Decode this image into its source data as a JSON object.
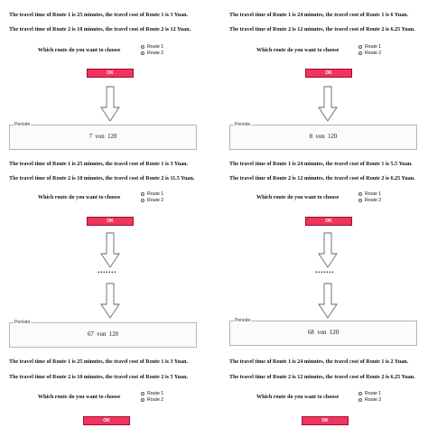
{
  "question": "Which route do you want to choose",
  "route_options": [
    "Route 1",
    "Route 2"
  ],
  "ok_label": "OK",
  "periode_label": "Periode",
  "ellipsis": ".......",
  "left": {
    "screen1": {
      "line1": "The travel time of Route 1 is 25 minutes, the travel cost of Route 1 is 3 Yuan.",
      "line2": "The travel time of Route 2 is 10 minutes, the travel cost of Route 2 is 12 Yuan."
    },
    "screen2": {
      "periode": "7  von  120",
      "line1": "The travel time of Route 1 is 25 minutes, the travel cost of Route 1 is 3 Yuan.",
      "line2": "The travel time of Route 2 is 10 minutes, the travel cost of Route 2 is 11.5 Yuan."
    },
    "screen3": {
      "periode": "67  von  120",
      "line1": "The travel time of Route 1 is 25 minutes, the travel cost of Route 1 is 3 Yuan.",
      "line2": "The travel time of Route 2 is 10 minutes, the travel cost of Route 2 is 5 Yuan."
    }
  },
  "right": {
    "screen1": {
      "line1": "The travel time of Route 1 is 24 minutes, the travel cost of Route 1 is 6 Yuan.",
      "line2": "The travel time of Route 2 is 12 minutes, the travel cost of Route 2 is 6.25 Yuan."
    },
    "screen2": {
      "periode": "8  von  120",
      "line1": "The travel time of Route 1 is 24 minutes, the travel cost of Route 1 is 5.5 Yuan.",
      "line2": "The travel time of Route 2 is 12 minutes, the travel cost of Route 2 is 6.25 Yuan."
    },
    "screen3": {
      "periode": "68  von  120",
      "line1": "The travel time of Route 1 is 24 minutes, the travel cost of Route 1 is 2 Yuan.",
      "line2": "The travel time of Route 2 is 12 minutes, the travel cost of Route 2 is 6.25 Yuan."
    }
  }
}
